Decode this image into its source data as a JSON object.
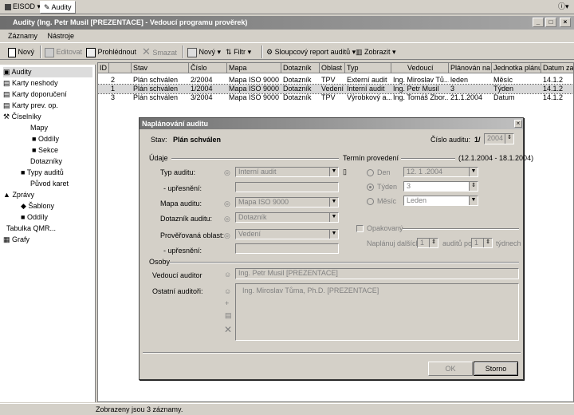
{
  "tabs": {
    "app": "EISOD",
    "audits": "Audity"
  },
  "title": "Audity (Ing. Petr Musil [PREZENTACE] - Vedoucí programu prověrek)",
  "menu": {
    "zaznamy": "Záznamy",
    "nastroje": "Nástroje"
  },
  "toolbar": {
    "novy": "Nový",
    "editovat": "Editovat",
    "prohlednout": "Prohlédnout",
    "smazat": "Smazat",
    "novy2": "Nový",
    "filtr": "Filtr",
    "report": "Sloupcový report auditů",
    "zobrazit": "Zobrazit"
  },
  "tree": [
    "Audity",
    "Karty neshody",
    "Karty doporučení",
    "Karty prev. op.",
    "Číselníky",
    "Mapy",
    "Oddíly",
    "Sekce",
    "Dotazníky",
    "Typy auditů",
    "Původ karet",
    "Zprávy",
    "Šablony",
    "Oddíly",
    "Tabulka QMR...",
    "Grafy"
  ],
  "grid": {
    "headers": [
      "ID",
      "Stav",
      "Číslo",
      "Mapa",
      "Dotazník",
      "Oblast",
      "Typ",
      "Vedoucí",
      "Plánován na",
      "Jednotka plánu",
      "Datum zah"
    ],
    "rows": [
      [
        "2",
        "Plán schválen",
        "2/2004",
        "Mapa ISO 9000",
        "Dotazník",
        "TPV",
        "Externí audit",
        "Ing. Miroslav Tů...",
        "leden",
        "Měsíc",
        "14.1.2"
      ],
      [
        "1",
        "Plán schválen",
        "1/2004",
        "Mapa ISO 9000",
        "Dotazník",
        "Vedení",
        "Interní audit",
        "Ing. Petr Musil",
        "3",
        "Týden",
        "14.1.2"
      ],
      [
        "3",
        "Plán schválen",
        "3/2004",
        "Mapa ISO 9000",
        "Dotazník",
        "TPV",
        "Výrobkový a...",
        "Ing. Tomáš Zbor...",
        "21.1.2004",
        "Datum",
        "14.1.2"
      ]
    ]
  },
  "status": "Zobrazeny jsou 3 záznamy.",
  "dialog": {
    "title": "Naplánování auditu",
    "stav_label": "Stav:",
    "stav_value": "Plán schválen",
    "cislo_label": "Číslo auditu:",
    "cislo_num": "1/",
    "cislo_year": "2004",
    "udaje": "Údaje",
    "typ_label": "Typ auditu:",
    "typ_value": "Interní audit",
    "upres_label": "- upřesnění:",
    "mapa_label": "Mapa auditu:",
    "mapa_value": "Mapa ISO 9000",
    "dotaznik_label": "Dotazník auditu:",
    "dotaznik_value": "Dotazník",
    "oblast_label": "Prověřovaná oblast:",
    "oblast_value": "Vedení",
    "termin": "Termín provedení",
    "termin_range": "(12.1.2004 - 18.1.2004)",
    "den": "Den",
    "den_value": "12. 1 .2004",
    "tyden": "Týden",
    "tyden_value": "3",
    "mesic": "Měsíc",
    "mesic_value": "Leden",
    "opakovany": "Opakovaný",
    "naplanuj": "Naplánuj dalších",
    "auditu_po": "auditů po",
    "tydnech": "týdnech",
    "naplanuj_val": "1",
    "auditu_val": "1",
    "osoby": "Osoby",
    "vedouci_label": "Vedoucí auditor",
    "vedouci_value": "Ing. Petr Musil [PREZENTACE]",
    "ostatni_label": "Ostatní auditoři:",
    "ostatni_value": "Ing. Miroslav Tůma, Ph.D. [PREZENTACE]",
    "ok": "OK",
    "storno": "Storno"
  }
}
